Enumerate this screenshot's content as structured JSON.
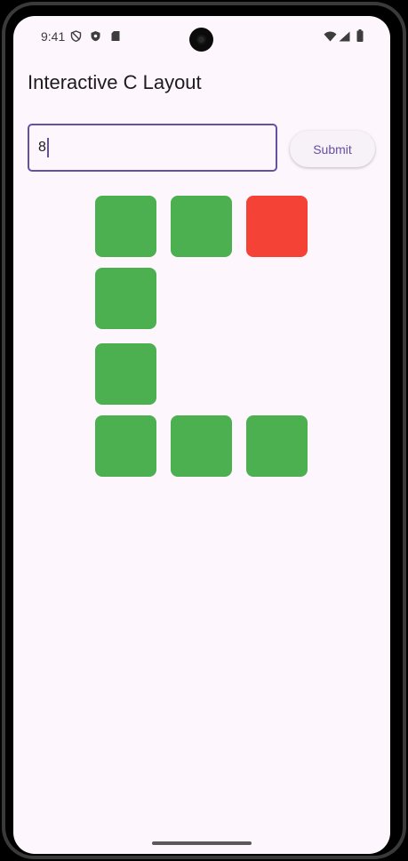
{
  "status_bar": {
    "time": "9:41",
    "left_icons": [
      "vpn-shield-icon",
      "security-shield-icon",
      "sd-card-icon"
    ],
    "right_icons": [
      "wifi-icon",
      "signal-icon",
      "battery-icon"
    ]
  },
  "app": {
    "title": "Interactive C Layout"
  },
  "input": {
    "value": "8",
    "placeholder": "",
    "accent_color": "#6750a4"
  },
  "submit_button": {
    "label": "Submit"
  },
  "grid": {
    "colors": {
      "active": "#4caf50",
      "highlight": "#f44336"
    },
    "rows": [
      [
        "active",
        "active",
        "highlight"
      ],
      [
        "active",
        "empty",
        "empty"
      ],
      [
        "active",
        "empty",
        "empty"
      ],
      [
        "active",
        "active",
        "active"
      ]
    ]
  }
}
